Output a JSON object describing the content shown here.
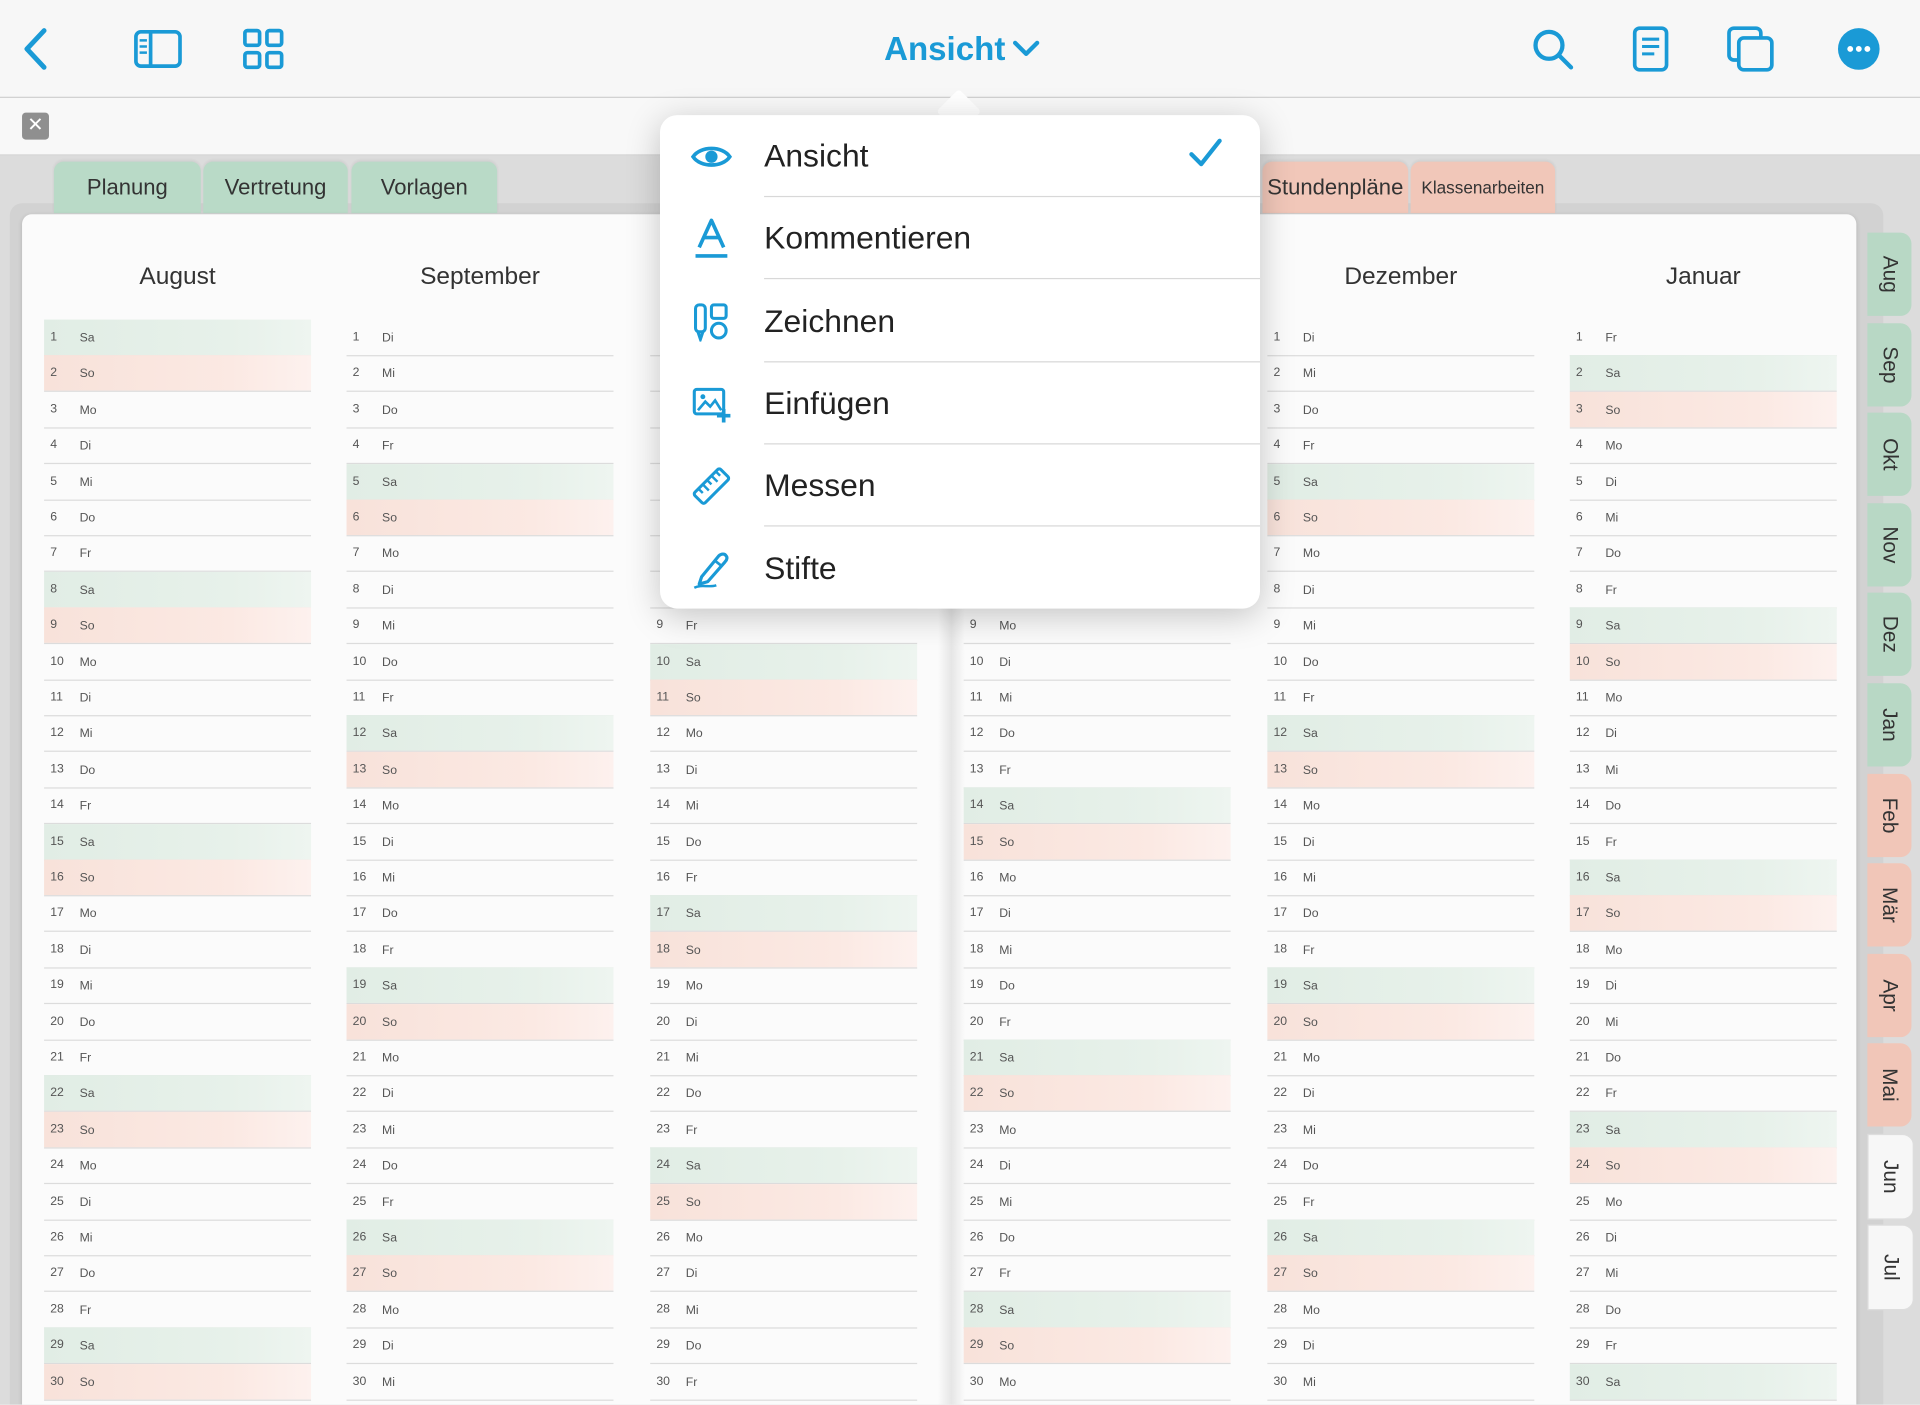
{
  "toolbar": {
    "title": "Ansicht",
    "accent": "#1a9ad6",
    "icons": [
      "back-chevron-icon",
      "sidebar-icon",
      "grid-icon",
      "search-icon",
      "document-icon",
      "pages-icon",
      "more-icon"
    ]
  },
  "tabs_left": [
    "Planung",
    "Vertretung",
    "Vorlagen"
  ],
  "tabs_right": [
    "Stundenpläne",
    "Klassenarbeiten"
  ],
  "calendar": {
    "months": [
      {
        "name": "August",
        "days": [
          [
            "1",
            "Sa"
          ],
          [
            "2",
            "So"
          ],
          [
            "3",
            "Mo"
          ],
          [
            "4",
            "Di"
          ],
          [
            "5",
            "Mi"
          ],
          [
            "6",
            "Do"
          ],
          [
            "7",
            "Fr"
          ],
          [
            "8",
            "Sa"
          ],
          [
            "9",
            "So"
          ],
          [
            "10",
            "Mo"
          ],
          [
            "11",
            "Di"
          ],
          [
            "12",
            "Mi"
          ],
          [
            "13",
            "Do"
          ],
          [
            "14",
            "Fr"
          ],
          [
            "15",
            "Sa"
          ],
          [
            "16",
            "So"
          ],
          [
            "17",
            "Mo"
          ],
          [
            "18",
            "Di"
          ],
          [
            "19",
            "Mi"
          ],
          [
            "20",
            "Do"
          ],
          [
            "21",
            "Fr"
          ],
          [
            "22",
            "Sa"
          ],
          [
            "23",
            "So"
          ],
          [
            "24",
            "Mo"
          ],
          [
            "25",
            "Di"
          ],
          [
            "26",
            "Mi"
          ],
          [
            "27",
            "Do"
          ],
          [
            "28",
            "Fr"
          ],
          [
            "29",
            "Sa"
          ],
          [
            "30",
            "So"
          ]
        ]
      },
      {
        "name": "September",
        "days": [
          [
            "1",
            "Di"
          ],
          [
            "2",
            "Mi"
          ],
          [
            "3",
            "Do"
          ],
          [
            "4",
            "Fr"
          ],
          [
            "5",
            "Sa"
          ],
          [
            "6",
            "So"
          ],
          [
            "7",
            "Mo"
          ],
          [
            "8",
            "Di"
          ],
          [
            "9",
            "Mi"
          ],
          [
            "10",
            "Do"
          ],
          [
            "11",
            "Fr"
          ],
          [
            "12",
            "Sa"
          ],
          [
            "13",
            "So"
          ],
          [
            "14",
            "Mo"
          ],
          [
            "15",
            "Di"
          ],
          [
            "16",
            "Mi"
          ],
          [
            "17",
            "Do"
          ],
          [
            "18",
            "Fr"
          ],
          [
            "19",
            "Sa"
          ],
          [
            "20",
            "So"
          ],
          [
            "21",
            "Mo"
          ],
          [
            "22",
            "Di"
          ],
          [
            "23",
            "Mi"
          ],
          [
            "24",
            "Do"
          ],
          [
            "25",
            "Fr"
          ],
          [
            "26",
            "Sa"
          ],
          [
            "27",
            "So"
          ],
          [
            "28",
            "Mo"
          ],
          [
            "29",
            "Di"
          ],
          [
            "30",
            "Mi"
          ]
        ]
      },
      {
        "name": "",
        "days": [
          [
            "",
            "",
            ""
          ],
          [
            "",
            "",
            ""
          ],
          [
            "",
            "",
            ""
          ],
          [
            "",
            "",
            ""
          ],
          [
            "",
            "",
            ""
          ],
          [
            "",
            "",
            ""
          ],
          [
            "",
            "",
            ""
          ],
          [
            "",
            "",
            ""
          ],
          [
            "9",
            "Fr"
          ],
          [
            "10",
            "Sa"
          ],
          [
            "11",
            "So"
          ],
          [
            "12",
            "Mo"
          ],
          [
            "13",
            "Di"
          ],
          [
            "14",
            "Mi"
          ],
          [
            "15",
            "Do"
          ],
          [
            "16",
            "Fr"
          ],
          [
            "17",
            "Sa"
          ],
          [
            "18",
            "So"
          ],
          [
            "19",
            "Mo"
          ],
          [
            "20",
            "Di"
          ],
          [
            "21",
            "Mi"
          ],
          [
            "22",
            "Do"
          ],
          [
            "23",
            "Fr"
          ],
          [
            "24",
            "Sa"
          ],
          [
            "25",
            "So"
          ],
          [
            "26",
            "Mo"
          ],
          [
            "27",
            "Di"
          ],
          [
            "28",
            "Mi"
          ],
          [
            "29",
            "Do"
          ],
          [
            "30",
            "Fr"
          ]
        ]
      },
      {
        "name": "",
        "days": [
          [
            "",
            "",
            ""
          ],
          [
            "",
            "",
            ""
          ],
          [
            "",
            "",
            ""
          ],
          [
            "",
            "",
            ""
          ],
          [
            "",
            "",
            ""
          ],
          [
            "",
            "",
            ""
          ],
          [
            "",
            "",
            ""
          ],
          [
            "",
            "",
            ""
          ],
          [
            "9",
            "Mo"
          ],
          [
            "10",
            "Di"
          ],
          [
            "11",
            "Mi"
          ],
          [
            "12",
            "Do"
          ],
          [
            "13",
            "Fr"
          ],
          [
            "14",
            "Sa"
          ],
          [
            "15",
            "So"
          ],
          [
            "16",
            "Mo"
          ],
          [
            "17",
            "Di"
          ],
          [
            "18",
            "Mi"
          ],
          [
            "19",
            "Do"
          ],
          [
            "20",
            "Fr"
          ],
          [
            "21",
            "Sa"
          ],
          [
            "22",
            "So"
          ],
          [
            "23",
            "Mo"
          ],
          [
            "24",
            "Di"
          ],
          [
            "25",
            "Mi"
          ],
          [
            "26",
            "Do"
          ],
          [
            "27",
            "Fr"
          ],
          [
            "28",
            "Sa"
          ],
          [
            "29",
            "So"
          ],
          [
            "30",
            "Mo"
          ]
        ]
      },
      {
        "name": "Dezember",
        "days": [
          [
            "1",
            "Di"
          ],
          [
            "2",
            "Mi"
          ],
          [
            "3",
            "Do"
          ],
          [
            "4",
            "Fr"
          ],
          [
            "5",
            "Sa"
          ],
          [
            "6",
            "So"
          ],
          [
            "7",
            "Mo"
          ],
          [
            "8",
            "Di"
          ],
          [
            "9",
            "Mi"
          ],
          [
            "10",
            "Do"
          ],
          [
            "11",
            "Fr"
          ],
          [
            "12",
            "Sa"
          ],
          [
            "13",
            "So"
          ],
          [
            "14",
            "Mo"
          ],
          [
            "15",
            "Di"
          ],
          [
            "16",
            "Mi"
          ],
          [
            "17",
            "Do"
          ],
          [
            "18",
            "Fr"
          ],
          [
            "19",
            "Sa"
          ],
          [
            "20",
            "So"
          ],
          [
            "21",
            "Mo"
          ],
          [
            "22",
            "Di"
          ],
          [
            "23",
            "Mi"
          ],
          [
            "24",
            "Do"
          ],
          [
            "25",
            "Fr"
          ],
          [
            "26",
            "Sa"
          ],
          [
            "27",
            "So"
          ],
          [
            "28",
            "Mo"
          ],
          [
            "29",
            "Di"
          ],
          [
            "30",
            "Mi"
          ]
        ]
      },
      {
        "name": "Januar",
        "days": [
          [
            "1",
            "Fr"
          ],
          [
            "2",
            "Sa"
          ],
          [
            "3",
            "So"
          ],
          [
            "4",
            "Mo"
          ],
          [
            "5",
            "Di"
          ],
          [
            "6",
            "Mi"
          ],
          [
            "7",
            "Do"
          ],
          [
            "8",
            "Fr"
          ],
          [
            "9",
            "Sa"
          ],
          [
            "10",
            "So"
          ],
          [
            "11",
            "Mo"
          ],
          [
            "12",
            "Di"
          ],
          [
            "13",
            "Mi"
          ],
          [
            "14",
            "Do"
          ],
          [
            "15",
            "Fr"
          ],
          [
            "16",
            "Sa"
          ],
          [
            "17",
            "So"
          ],
          [
            "18",
            "Mo"
          ],
          [
            "19",
            "Di"
          ],
          [
            "20",
            "Mi"
          ],
          [
            "21",
            "Do"
          ],
          [
            "22",
            "Fr"
          ],
          [
            "23",
            "Sa"
          ],
          [
            "24",
            "So"
          ],
          [
            "25",
            "Mo"
          ],
          [
            "26",
            "Di"
          ],
          [
            "27",
            "Mi"
          ],
          [
            "28",
            "Do"
          ],
          [
            "29",
            "Fr"
          ],
          [
            "30",
            "Sa"
          ]
        ]
      }
    ]
  },
  "side_tabs": [
    {
      "label": "Aug",
      "color": "green"
    },
    {
      "label": "Sep",
      "color": "green"
    },
    {
      "label": "Okt",
      "color": "green"
    },
    {
      "label": "Nov",
      "color": "green"
    },
    {
      "label": "Dez",
      "color": "green"
    },
    {
      "label": "Jan",
      "color": "green"
    },
    {
      "label": "Feb",
      "color": "pink"
    },
    {
      "label": "Mär",
      "color": "pink"
    },
    {
      "label": "Apr",
      "color": "pink"
    },
    {
      "label": "Mai",
      "color": "pink"
    },
    {
      "label": "Jun",
      "color": "white"
    },
    {
      "label": "Jul",
      "color": "white"
    }
  ],
  "menu": {
    "items": [
      {
        "label": "Ansicht",
        "icon": "eye-icon",
        "checked": true
      },
      {
        "label": "Kommentieren",
        "icon": "text-annotation-icon",
        "checked": false
      },
      {
        "label": "Zeichnen",
        "icon": "drawing-tools-icon",
        "checked": false
      },
      {
        "label": "Einfügen",
        "icon": "insert-image-icon",
        "checked": false
      },
      {
        "label": "Messen",
        "icon": "ruler-icon",
        "checked": false
      },
      {
        "label": "Stifte",
        "icon": "pen-icon",
        "checked": false
      }
    ]
  }
}
